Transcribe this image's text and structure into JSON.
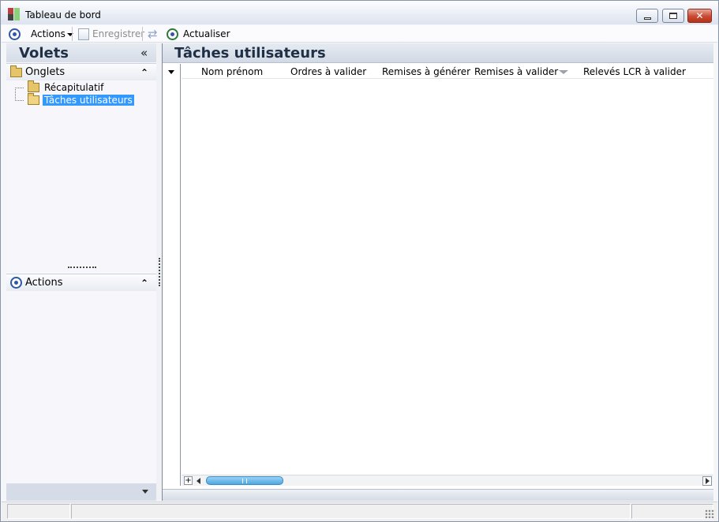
{
  "window": {
    "title": "Tableau de bord",
    "close_glyph": "✕"
  },
  "toolbar": {
    "actions_label": "Actions",
    "save_label": "Enregistrer",
    "refresh_label": "Actualiser"
  },
  "left_panel": {
    "title": "Volets",
    "collapse_glyph": "«",
    "groups": [
      {
        "label": "Onglets",
        "chevron": "⌃",
        "items": [
          {
            "label": "Récapitulatif",
            "selected": false
          },
          {
            "label": "Tâches utilisateurs",
            "selected": true
          }
        ]
      },
      {
        "label": "Actions",
        "chevron": "⌃",
        "items": []
      }
    ]
  },
  "main_panel": {
    "title": "Tâches utilisateurs",
    "columns": [
      "Nom prénom",
      "Ordres à valider",
      "Remises à générer",
      "Remises à valider",
      "Relevés LCR à valider"
    ],
    "rows": [],
    "scroll_add": "+"
  },
  "colors": {
    "selection": "#3399ff",
    "header_text": "#1f2f46",
    "scroll_thumb": "#4ea8e0"
  }
}
